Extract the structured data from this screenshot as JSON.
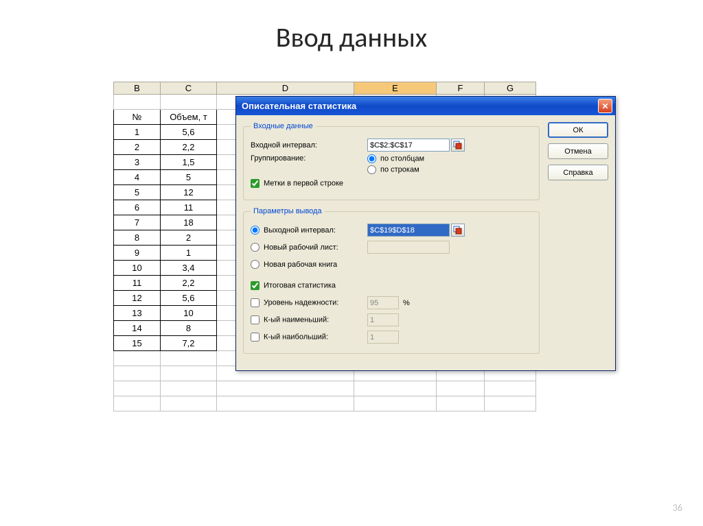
{
  "slide": {
    "title": "Ввод данных",
    "number": "36"
  },
  "columns": [
    "B",
    "C",
    "D",
    "E",
    "F",
    "G"
  ],
  "table": {
    "headers": [
      "№",
      "Объем, т"
    ],
    "rows": [
      [
        "1",
        "5,6"
      ],
      [
        "2",
        "2,2"
      ],
      [
        "3",
        "1,5"
      ],
      [
        "4",
        "5"
      ],
      [
        "5",
        "12"
      ],
      [
        "6",
        "11"
      ],
      [
        "7",
        "18"
      ],
      [
        "8",
        "2"
      ],
      [
        "9",
        "1"
      ],
      [
        "10",
        "3,4"
      ],
      [
        "11",
        "2,2"
      ],
      [
        "12",
        "5,6"
      ],
      [
        "13",
        "10"
      ],
      [
        "14",
        "8"
      ],
      [
        "15",
        "7,2"
      ]
    ]
  },
  "dialog": {
    "title": "Описательная статистика",
    "close": "✕",
    "buttons": {
      "ok": "ОК",
      "cancel": "Отмена",
      "help": "Справка"
    },
    "inputGroup": {
      "legend": "Входные данные",
      "inputInterval": "Входной интервал:",
      "inputIntervalValue": "$C$2:$C$17",
      "grouping": "Группирование:",
      "byCols": "по столбцам",
      "byRows": "по строкам",
      "labels": "Метки в первой строке"
    },
    "outputGroup": {
      "legend": "Параметры вывода",
      "outInterval": "Выходной интервал:",
      "outIntervalValue": "$C$19$D$18",
      "newSheet": "Новый рабочий лист:",
      "newBook": "Новая рабочая книга",
      "summary": "Итоговая статистика",
      "confidence": "Уровень надежности:",
      "confidenceValue": "95",
      "pct": "%",
      "kthMin": "К-ый наименьший:",
      "kthMinValue": "1",
      "kthMax": "К-ый наибольший:",
      "kthMaxValue": "1"
    }
  }
}
